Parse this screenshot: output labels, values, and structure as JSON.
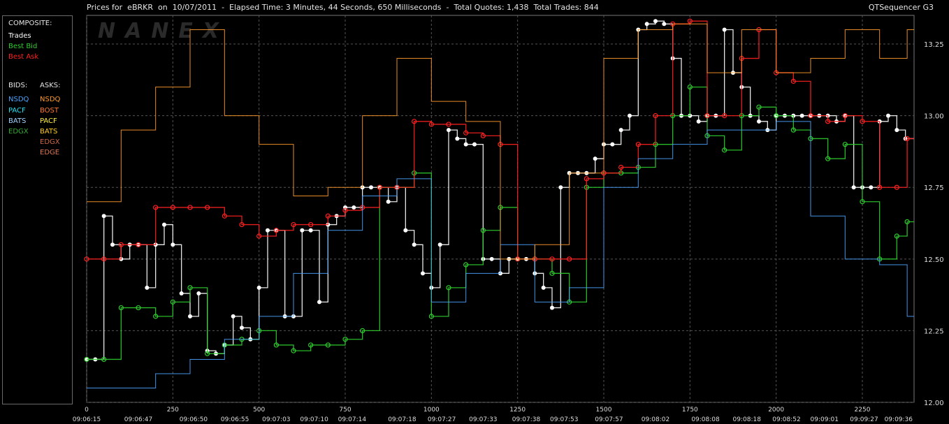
{
  "header": {
    "title": "Prices for  eBRKR  on  10/07/2011  -  Elapsed Time: 3 Minutes, 44 Seconds, 650 Milliseconds  -  Total Quotes: 1,438  Total Trades: 844",
    "app_name": "QTSequencer G3"
  },
  "watermark": "NANEX",
  "legend": {
    "composite_heading": "COMPOSITE:",
    "composite": [
      {
        "label": "Trades",
        "color": "#ffffff"
      },
      {
        "label": "Best Bid",
        "color": "#2ecc2e"
      },
      {
        "label": "Best Ask",
        "color": "#ff2020"
      }
    ],
    "bids_heading": "BIDS:",
    "asks_heading": "ASKS:",
    "bids": [
      {
        "label": "NSDQ",
        "color": "#4aa3ff"
      },
      {
        "label": "PACF",
        "color": "#28e0f0"
      },
      {
        "label": "BATS",
        "color": "#9fd0ff"
      },
      {
        "label": "EDGX",
        "color": "#33aa33"
      }
    ],
    "asks": [
      {
        "label": "NSDQ",
        "color": "#ff9a2a"
      },
      {
        "label": "BOST",
        "color": "#ff7a3a"
      },
      {
        "label": "PACF",
        "color": "#ffee33"
      },
      {
        "label": "BATS",
        "color": "#ffcc22"
      },
      {
        "label": "EDGX",
        "color": "#cc6644"
      },
      {
        "label": "EDGE",
        "color": "#dd7755"
      }
    ]
  },
  "chart_data": {
    "type": "line",
    "ylim": [
      12.0,
      13.35
    ],
    "xlim": [
      0,
      2400
    ],
    "y_ticks": [
      "12.00",
      "12.25",
      "12.50",
      "12.75",
      "13.00",
      "13.25"
    ],
    "x_ticks": [
      "0",
      "250",
      "500",
      "750",
      "1000",
      "1250",
      "1500",
      "1750",
      "2000",
      "2250"
    ],
    "time_labels": [
      {
        "x": 0,
        "label": "09:06:15"
      },
      {
        "x": 150,
        "label": "09:06:47"
      },
      {
        "x": 310,
        "label": "09:06:50"
      },
      {
        "x": 430,
        "label": "09:06:55"
      },
      {
        "x": 550,
        "label": "09:07:03"
      },
      {
        "x": 660,
        "label": "09:07:10"
      },
      {
        "x": 770,
        "label": "09:07:14"
      },
      {
        "x": 915,
        "label": "09:07:18"
      },
      {
        "x": 1030,
        "label": "09:07:27"
      },
      {
        "x": 1150,
        "label": "09:07:33"
      },
      {
        "x": 1275,
        "label": "09:07:38"
      },
      {
        "x": 1385,
        "label": "09:07:53"
      },
      {
        "x": 1515,
        "label": "09:07:57"
      },
      {
        "x": 1650,
        "label": "09:08:02"
      },
      {
        "x": 1795,
        "label": "09:08:08"
      },
      {
        "x": 1915,
        "label": "09:08:18"
      },
      {
        "x": 2030,
        "label": "09:08:52"
      },
      {
        "x": 2140,
        "label": "09:09:01"
      },
      {
        "x": 2255,
        "label": "09:09:27"
      },
      {
        "x": 2355,
        "label": "09:09:36"
      }
    ],
    "series": [
      {
        "name": "Trades",
        "color": "#ffffff",
        "x": [
          0,
          25,
          50,
          75,
          100,
          125,
          150,
          175,
          200,
          225,
          250,
          275,
          300,
          325,
          350,
          375,
          400,
          425,
          450,
          475,
          500,
          525,
          550,
          575,
          600,
          625,
          650,
          675,
          700,
          725,
          750,
          775,
          800,
          825,
          850,
          875,
          900,
          925,
          950,
          975,
          1000,
          1025,
          1050,
          1075,
          1100,
          1125,
          1150,
          1175,
          1200,
          1225,
          1250,
          1275,
          1300,
          1325,
          1350,
          1375,
          1400,
          1425,
          1450,
          1475,
          1500,
          1525,
          1550,
          1575,
          1600,
          1625,
          1650,
          1675,
          1700,
          1725,
          1750,
          1775,
          1800,
          1825,
          1850,
          1875,
          1900,
          1925,
          1950,
          1975,
          2000,
          2025,
          2050,
          2075,
          2100,
          2125,
          2150,
          2175,
          2200,
          2225,
          2250,
          2275,
          2300,
          2325,
          2350,
          2375
        ],
        "y": [
          12.15,
          12.15,
          12.65,
          12.55,
          12.5,
          12.55,
          12.55,
          12.4,
          12.55,
          12.62,
          12.55,
          12.38,
          12.3,
          12.38,
          12.18,
          12.17,
          12.2,
          12.3,
          12.26,
          12.22,
          12.4,
          12.6,
          12.6,
          12.3,
          12.3,
          12.6,
          12.6,
          12.35,
          12.62,
          12.65,
          12.68,
          12.68,
          12.75,
          12.75,
          12.75,
          12.7,
          12.75,
          12.6,
          12.55,
          12.45,
          12.4,
          12.55,
          12.95,
          12.92,
          12.9,
          12.9,
          12.5,
          12.5,
          12.45,
          12.5,
          12.5,
          12.5,
          12.45,
          12.4,
          12.33,
          12.75,
          12.8,
          12.8,
          12.8,
          12.85,
          12.9,
          12.9,
          12.95,
          13.0,
          13.3,
          13.32,
          13.33,
          13.32,
          13.2,
          13.0,
          13.0,
          12.98,
          13.0,
          13.0,
          13.3,
          13.15,
          13.1,
          13.0,
          12.98,
          12.95,
          13.0,
          13.0,
          13.0,
          13.0,
          13.0,
          13.0,
          13.0,
          12.98,
          13.0,
          12.75,
          12.75,
          12.75,
          12.98,
          13.0,
          12.95,
          12.92
        ]
      },
      {
        "name": "Best Bid",
        "color": "#2ecc2e",
        "x": [
          0,
          50,
          100,
          150,
          200,
          250,
          300,
          350,
          400,
          450,
          500,
          550,
          600,
          650,
          700,
          750,
          800,
          850,
          900,
          950,
          1000,
          1050,
          1100,
          1150,
          1200,
          1250,
          1300,
          1350,
          1400,
          1450,
          1500,
          1550,
          1600,
          1650,
          1700,
          1750,
          1800,
          1850,
          1900,
          1950,
          2000,
          2050,
          2100,
          2150,
          2200,
          2250,
          2300,
          2350,
          2380
        ],
        "y": [
          12.15,
          12.15,
          12.33,
          12.33,
          12.3,
          12.35,
          12.4,
          12.17,
          12.2,
          12.22,
          12.25,
          12.2,
          12.18,
          12.2,
          12.2,
          12.22,
          12.25,
          12.75,
          12.75,
          12.8,
          12.3,
          12.4,
          12.48,
          12.6,
          12.68,
          12.5,
          12.5,
          12.45,
          12.35,
          12.75,
          12.8,
          12.8,
          12.82,
          12.9,
          13.0,
          13.1,
          12.93,
          12.88,
          13.0,
          13.03,
          13.0,
          12.95,
          12.92,
          12.85,
          12.9,
          12.7,
          12.5,
          12.58,
          12.63
        ]
      },
      {
        "name": "Best Ask",
        "color": "#ff2020",
        "x": [
          0,
          50,
          100,
          150,
          200,
          250,
          300,
          350,
          400,
          450,
          500,
          550,
          600,
          650,
          700,
          750,
          800,
          850,
          900,
          950,
          1000,
          1050,
          1100,
          1150,
          1200,
          1250,
          1300,
          1350,
          1400,
          1450,
          1500,
          1550,
          1600,
          1650,
          1700,
          1750,
          1800,
          1850,
          1900,
          1950,
          2000,
          2050,
          2100,
          2150,
          2200,
          2250,
          2300,
          2350,
          2380
        ],
        "y": [
          12.5,
          12.5,
          12.55,
          12.55,
          12.68,
          12.68,
          12.68,
          12.68,
          12.65,
          12.62,
          12.58,
          12.6,
          12.62,
          12.62,
          12.65,
          12.67,
          12.68,
          12.75,
          12.75,
          12.98,
          12.97,
          12.97,
          12.94,
          12.93,
          12.9,
          12.5,
          12.5,
          12.5,
          12.5,
          12.78,
          12.8,
          12.82,
          12.9,
          13.0,
          13.32,
          13.33,
          13.0,
          13.0,
          13.2,
          13.3,
          13.15,
          13.12,
          13.0,
          12.98,
          13.0,
          12.98,
          12.75,
          12.75,
          12.92
        ]
      },
      {
        "name": "NSDQ",
        "color": "#4aa3ff",
        "x": [
          0,
          100,
          200,
          300,
          400,
          500,
          600,
          700,
          800,
          900,
          1000,
          1100,
          1200,
          1300,
          1400,
          1500,
          1600,
          1700,
          1800,
          1900,
          2000,
          2100,
          2200,
          2300,
          2380
        ],
        "y": [
          12.05,
          12.05,
          12.1,
          12.15,
          12.22,
          12.3,
          12.45,
          12.6,
          12.72,
          12.78,
          12.35,
          12.45,
          12.55,
          12.35,
          12.4,
          12.75,
          12.85,
          12.9,
          12.95,
          12.95,
          12.98,
          12.65,
          12.5,
          12.48,
          12.3
        ]
      },
      {
        "name": "NSDQ",
        "color": "#ff9a2a",
        "x": [
          0,
          100,
          200,
          300,
          400,
          500,
          600,
          700,
          800,
          900,
          1000,
          1100,
          1200,
          1300,
          1400,
          1500,
          1600,
          1700,
          1800,
          1900,
          2000,
          2100,
          2200,
          2300,
          2380
        ],
        "y": [
          12.7,
          12.95,
          13.1,
          13.3,
          13.0,
          12.9,
          12.72,
          12.75,
          13.0,
          13.2,
          13.05,
          12.98,
          12.5,
          12.55,
          12.8,
          13.2,
          13.3,
          13.32,
          13.15,
          13.3,
          13.15,
          13.2,
          13.3,
          13.2,
          13.3
        ]
      }
    ]
  }
}
